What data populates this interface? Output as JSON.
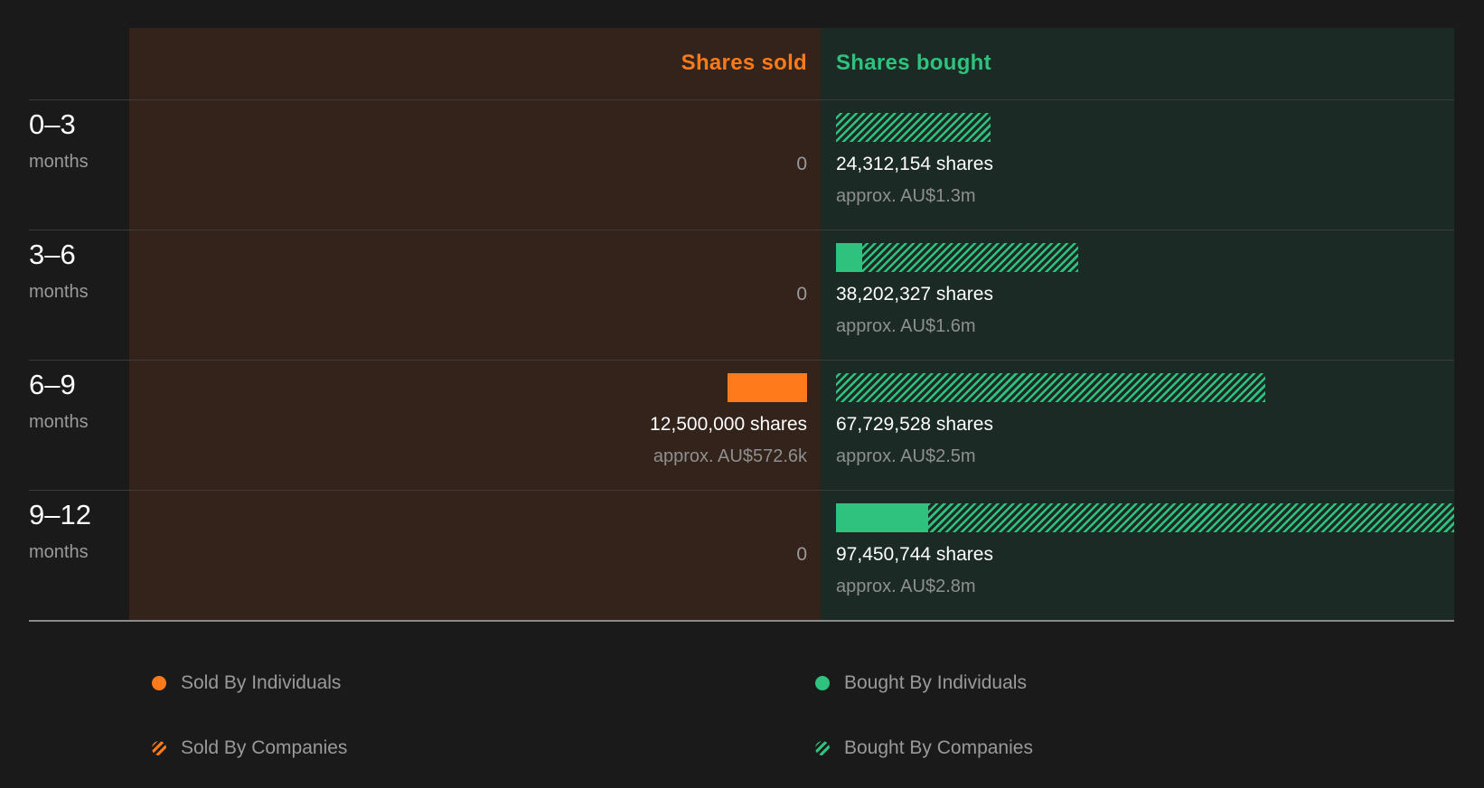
{
  "colors": {
    "sold": "#ff7a1a",
    "bought": "#2ec27e",
    "sold_bg": "#33231b",
    "bought_bg": "#1b2a24",
    "stripe_bought": "#2ec27e",
    "stripe_sold": "#ff7a1a"
  },
  "header": {
    "sold_label": "Shares sold",
    "bought_label": "Shares bought"
  },
  "chart_data": {
    "type": "bar",
    "orientation": "horizontal-diverging",
    "categories": [
      "0–3 months",
      "3–6 months",
      "6–9 months",
      "9–12 months"
    ],
    "series": [
      {
        "name": "Sold By Individuals",
        "values": [
          0,
          0,
          12500000,
          0
        ]
      },
      {
        "name": "Sold By Companies",
        "values": [
          0,
          0,
          0,
          0
        ]
      },
      {
        "name": "Bought By Individuals",
        "values": [
          0,
          4200000,
          0,
          14500000
        ]
      },
      {
        "name": "Bought By Companies",
        "values": [
          24312154,
          34002327,
          67729528,
          82950744
        ]
      }
    ],
    "rows": [
      {
        "period": "0–3",
        "unit": "months",
        "sold_total": 0,
        "sold_label": "0",
        "sold_approx": "",
        "bought_total": 24312154,
        "bought_label": "24,312,154 shares",
        "bought_approx": "approx. AU$1.3m",
        "sold_individuals": 0,
        "sold_companies": 0,
        "bought_individuals": 0,
        "bought_companies": 24312154
      },
      {
        "period": "3–6",
        "unit": "months",
        "sold_total": 0,
        "sold_label": "0",
        "sold_approx": "",
        "bought_total": 38202327,
        "bought_label": "38,202,327 shares",
        "bought_approx": "approx. AU$1.6m",
        "sold_individuals": 0,
        "sold_companies": 0,
        "bought_individuals": 4200000,
        "bought_companies": 34002327
      },
      {
        "period": "6–9",
        "unit": "months",
        "sold_total": 12500000,
        "sold_label": "12,500,000 shares",
        "sold_approx": "approx. AU$572.6k",
        "bought_total": 67729528,
        "bought_label": "67,729,528 shares",
        "bought_approx": "approx. AU$2.5m",
        "sold_individuals": 12500000,
        "sold_companies": 0,
        "bought_individuals": 0,
        "bought_companies": 67729528
      },
      {
        "period": "9–12",
        "unit": "months",
        "sold_total": 0,
        "sold_label": "0",
        "sold_approx": "",
        "bought_total": 97450744,
        "bought_label": "97,450,744 shares",
        "bought_approx": "approx. AU$2.8m",
        "sold_individuals": 0,
        "sold_companies": 0,
        "bought_individuals": 14500000,
        "bought_companies": 82950744
      }
    ],
    "max_value": 97450744,
    "legend": [
      {
        "label": "Sold By Individuals",
        "style": "solid",
        "color": "#ff7a1a"
      },
      {
        "label": "Bought By Individuals",
        "style": "solid",
        "color": "#2ec27e"
      },
      {
        "label": "Sold By Companies",
        "style": "striped",
        "color": "#ff7a1a"
      },
      {
        "label": "Bought By Companies",
        "style": "striped",
        "color": "#2ec27e"
      }
    ],
    "legend_placement": "bottom"
  }
}
